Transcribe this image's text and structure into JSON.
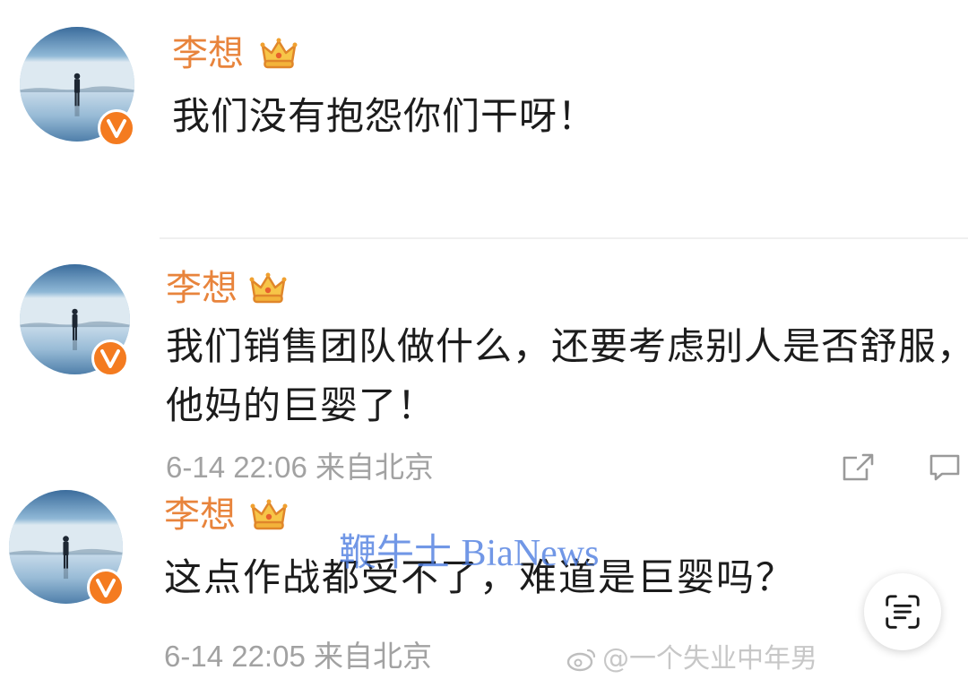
{
  "posts": [
    {
      "author": "李想",
      "text_lines": [
        "我们没有抱怨你们干呀！"
      ]
    },
    {
      "author": "李想",
      "text_lines": [
        "我们销售团队做什么，还要考虑别人是否舒服，",
        "他妈的巨婴了！"
      ],
      "meta": "6-14 22:06 来自北京"
    },
    {
      "author": "李想",
      "text_lines": [
        "这点作战都受不了，难道是巨婴吗？"
      ],
      "meta": "6-14 22:05 来自北京"
    }
  ],
  "watermarks": {
    "overlay": "鞭牛士 BiaNews",
    "weibo_handle": "@一个失业中年男"
  },
  "icons": {
    "author_badge": "crown-icon",
    "verified": "verified-badge-icon",
    "share": "share-icon",
    "comment": "comment-icon",
    "floating_button": "live-text-icon",
    "weibo_logo": "weibo-logo-icon"
  },
  "colors": {
    "author_name": "#e8843c",
    "body_text": "#1c1c1c",
    "meta_text": "#a2a2a2",
    "verified_badge": "#f47b20",
    "overlay_watermark": "#4a7be0"
  }
}
